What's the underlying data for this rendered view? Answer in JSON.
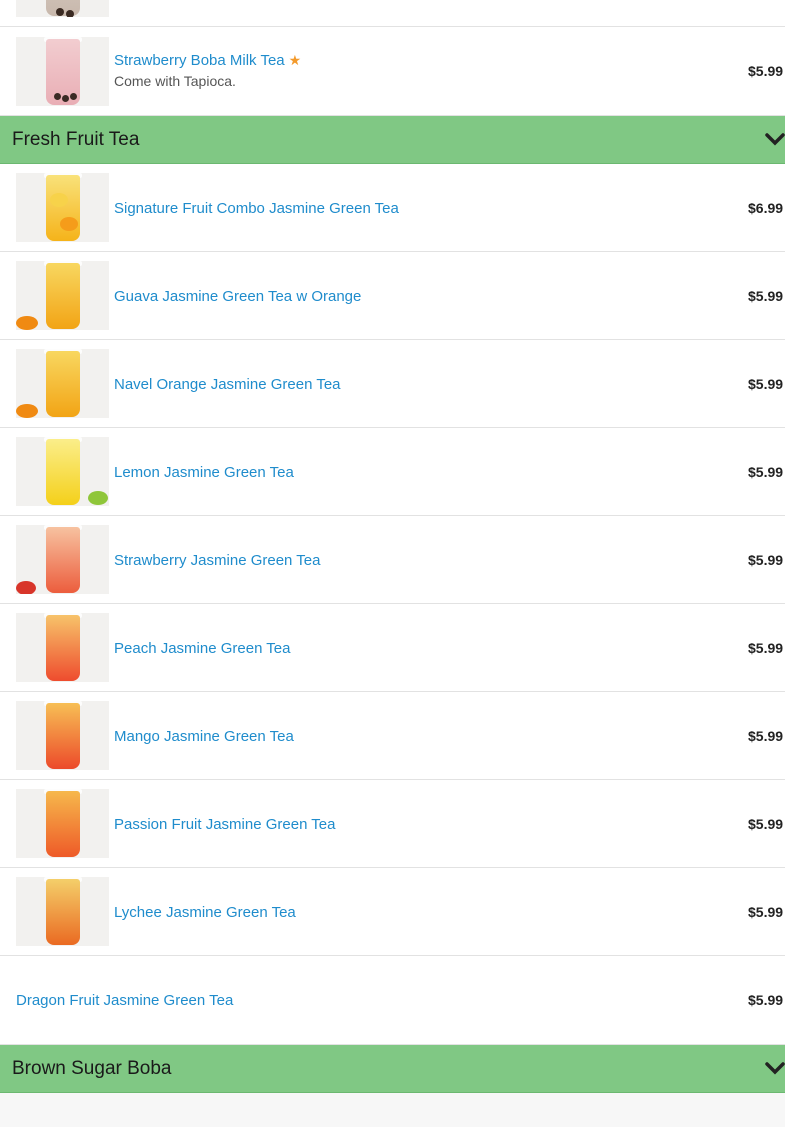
{
  "top_item": {
    "name": "Strawberry Boba Milk Tea",
    "description": "Come with Tapioca.",
    "price": "$5.99"
  },
  "categories": [
    {
      "title": "Fresh Fruit Tea"
    },
    {
      "title": "Brown Sugar Boba"
    }
  ],
  "fresh_fruit_items": [
    {
      "name": "Signature Fruit Combo Jasmine Green Tea",
      "price": "$6.99"
    },
    {
      "name": "Guava Jasmine Green Tea w Orange",
      "price": "$5.99"
    },
    {
      "name": "Navel Orange Jasmine Green Tea",
      "price": "$5.99"
    },
    {
      "name": "Lemon Jasmine Green Tea",
      "price": "$5.99"
    },
    {
      "name": "Strawberry Jasmine Green Tea",
      "price": "$5.99"
    },
    {
      "name": "Peach Jasmine Green Tea",
      "price": "$5.99"
    },
    {
      "name": "Mango Jasmine Green Tea",
      "price": "$5.99"
    },
    {
      "name": "Passion Fruit Jasmine Green Tea",
      "price": "$5.99"
    },
    {
      "name": "Lychee Jasmine Green Tea",
      "price": "$5.99"
    },
    {
      "name": "Dragon Fruit Jasmine Green Tea",
      "price": "$5.99"
    }
  ],
  "icons": {
    "popular": "star-icon",
    "collapse": "chevron-down-icon"
  },
  "colors": {
    "category_bar": "#80c884",
    "link": "#1f8ccc",
    "star": "#f39a2b"
  }
}
